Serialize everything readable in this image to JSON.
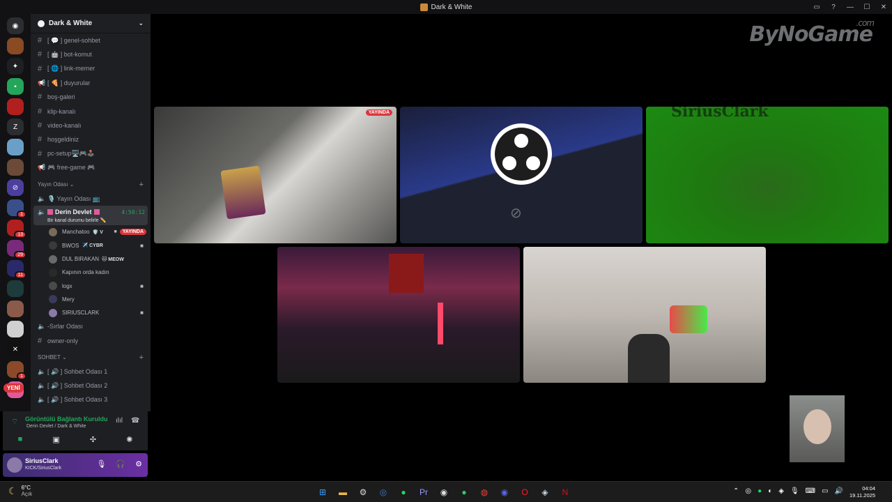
{
  "window": {
    "title": "Dark & White",
    "controls": [
      "inbox-icon",
      "help-icon",
      "minimize",
      "maximize",
      "close"
    ]
  },
  "servers": [
    {
      "name": "discord-home",
      "color": "#2b2d31",
      "glyph": "◉"
    },
    {
      "name": "server-1",
      "color": "#8a4a22",
      "glyph": ""
    },
    {
      "name": "server-2",
      "color": "#1e1f22",
      "glyph": "✦"
    },
    {
      "name": "server-3",
      "color": "#23a55a",
      "glyph": "▪"
    },
    {
      "name": "server-4",
      "color": "#b21f1f",
      "glyph": ""
    },
    {
      "name": "server-5",
      "color": "#2b2d31",
      "glyph": "Z"
    },
    {
      "name": "server-6",
      "color": "#6aa0c8",
      "glyph": ""
    },
    {
      "name": "server-7",
      "color": "#6b4a3a",
      "glyph": ""
    },
    {
      "name": "server-8",
      "color": "#4b3f9e",
      "glyph": "⊘"
    },
    {
      "name": "server-9",
      "color": "#3a4f8a",
      "glyph": "",
      "badge": "1"
    },
    {
      "name": "server-10",
      "color": "#b21f1f",
      "glyph": "",
      "badge": "13"
    },
    {
      "name": "server-11",
      "color": "#7a2a7a",
      "glyph": "",
      "badge": "29"
    },
    {
      "name": "server-12",
      "color": "#2a2a6a",
      "glyph": "",
      "badge": "11"
    },
    {
      "name": "server-13",
      "color": "#1e3a3a",
      "glyph": ""
    },
    {
      "name": "server-14",
      "color": "#8a5a4a",
      "glyph": ""
    },
    {
      "name": "server-15",
      "color": "#d0d0d0",
      "glyph": ""
    },
    {
      "name": "server-16",
      "color": "#111111",
      "glyph": "✕"
    },
    {
      "name": "server-17",
      "color": "#8a4a2a",
      "glyph": "",
      "badge": "1"
    },
    {
      "name": "server-18",
      "color": "#e05a9a",
      "glyph": ""
    }
  ],
  "new_badge": "YENİ",
  "guild": {
    "name": "Dark & White"
  },
  "text_channels": [
    {
      "label": "[ 💬 ] genel-sohbet",
      "icon": "hash"
    },
    {
      "label": "[ 🤖 ] bot-komut",
      "icon": "hash"
    },
    {
      "label": "[ 🌐 ] link-memer",
      "icon": "hash"
    },
    {
      "label": "[ 🍕 ] duyurular",
      "icon": "megaphone"
    },
    {
      "label": "boş-galeri",
      "icon": "hash"
    },
    {
      "label": "klip-kanalı",
      "icon": "hash"
    },
    {
      "label": "video-kanalı",
      "icon": "hash"
    },
    {
      "label": "hoşgeldiniz",
      "icon": "hash"
    },
    {
      "label": "pc-setup🖥️🎮🕹️",
      "icon": "hash"
    },
    {
      "label": "🎮 free-game 🎮",
      "icon": "megaphone"
    }
  ],
  "category_stream": "Yayın Odası",
  "voice_stream_room": "🎙️ Yayın Odası 📺",
  "active_channel": {
    "name": "Derin Devlet",
    "timer": "4:50:12",
    "status": "Bir kanal durumu belirle ✏️"
  },
  "voice_users": [
    {
      "name": "Manchatoo",
      "tag": "🛡️ V",
      "live": "YAYINDA",
      "cam": true,
      "color": "#7a6a5a"
    },
    {
      "name": "BWOS",
      "tag": "✈️ CYBR",
      "cam": true,
      "color": "#3a3a3a"
    },
    {
      "name": "DUL BIRAKAN",
      "tag": "🐱 MEOW",
      "cam": false,
      "color": "#6a6a6a"
    },
    {
      "name": "Kapının orda kadın",
      "tag": "",
      "cam": false,
      "color": "#2a2a2a"
    },
    {
      "name": "logx",
      "tag": "",
      "cam": true,
      "color": "#4a4a4a"
    },
    {
      "name": "Mery",
      "tag": "",
      "cam": false,
      "color": "#3a3a5a"
    },
    {
      "name": "SIRIUSCLARK",
      "tag": "",
      "cam": true,
      "color": "#8b7aa8"
    }
  ],
  "extra_channels": [
    {
      "label": "-Sırlar Odası",
      "icon": "speaker"
    },
    {
      "label": "owner-only",
      "icon": "hash"
    }
  ],
  "category_sohbet": "SOHBET",
  "sohbet_channels": [
    {
      "label": "[ 🔊 ] Sohbet Odası 1"
    },
    {
      "label": "[ 🔊 ] Sohbet Odası 2"
    },
    {
      "label": "[ 🔊 ] Sohbet Odası 3"
    }
  ],
  "voice_panel": {
    "status": "Görüntülü Bağlantı Kuruldu",
    "sub": "Derin Devlet / Dark & White"
  },
  "user_panel": {
    "name": "SiriusClark",
    "status": "KICK/SiriusClark"
  },
  "stage": {
    "watermark": "ByNoGame",
    "watermark_suffix": ".com",
    "live_label": "YAYINDA",
    "green_caption": "SiriusClark"
  },
  "taskbar": {
    "weather_temp": "6°C",
    "weather_desc": "Açık",
    "time": "04:04",
    "date": "19.11.2025",
    "apps": [
      {
        "name": "start",
        "glyph": "⊞",
        "color": "#3aa0ff"
      },
      {
        "name": "file-explorer",
        "glyph": "▬",
        "color": "#e8b84a"
      },
      {
        "name": "settings",
        "glyph": "⚙",
        "color": "#dddddd"
      },
      {
        "name": "app-blue",
        "glyph": "◎",
        "color": "#3a7bd5"
      },
      {
        "name": "spotify",
        "glyph": "●",
        "color": "#1ed760"
      },
      {
        "name": "premiere",
        "glyph": "Pr",
        "color": "#9999ff"
      },
      {
        "name": "obs",
        "glyph": "◉",
        "color": "#dddddd"
      },
      {
        "name": "whatsapp",
        "glyph": "●",
        "color": "#25d366"
      },
      {
        "name": "chrome",
        "glyph": "◍",
        "color": "#e8453c"
      },
      {
        "name": "discord",
        "glyph": "◉",
        "color": "#5865f2"
      },
      {
        "name": "opera",
        "glyph": "O",
        "color": "#ff1b2d"
      },
      {
        "name": "steam",
        "glyph": "◈",
        "color": "#c7d5e0"
      },
      {
        "name": "netflix",
        "glyph": "N",
        "color": "#e50914"
      }
    ]
  }
}
